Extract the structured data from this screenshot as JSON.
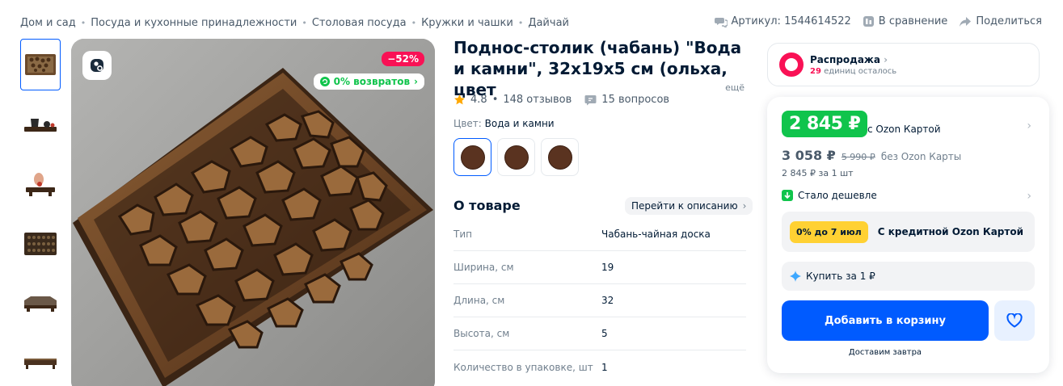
{
  "breadcrumbs": [
    "Дом и сад",
    "Посуда и кухонные принадлежности",
    "Столовая посуда",
    "Кружки и чашки",
    "Дайчай"
  ],
  "top_actions": {
    "article": "Артикул: 1544614522",
    "compare": "В сравнение",
    "share": "Поделиться"
  },
  "gallery": {
    "discount_badge": "−52%",
    "returns_badge": "0% возвратов",
    "thumbnails": [
      "thumb-top",
      "thumb-teaset",
      "thumb-hand",
      "thumb-pattern",
      "thumb-side",
      "thumb-edge"
    ]
  },
  "product": {
    "title": "Поднос-столик (чабань) \"Вода и камни\", 32x19x5 см (ольха, цвет",
    "title_more": "ещё",
    "rating": "4.8",
    "reviews": "148 отзывов",
    "questions": "15 вопросов",
    "color_label": "Цвет:",
    "color_value": "Вода и камни",
    "about_title": "О товаре",
    "goto_description": "Перейти к описанию",
    "specs": [
      {
        "k": "Тип",
        "v": "Чабань-чайная доска"
      },
      {
        "k": "Ширина, см",
        "v": "19"
      },
      {
        "k": "Длина, см",
        "v": "32"
      },
      {
        "k": "Высота, см",
        "v": "5"
      },
      {
        "k": "Количество в упаковке, шт",
        "v": "1"
      }
    ]
  },
  "sale": {
    "title": "Распродажа",
    "count": "29",
    "remaining": "единиц осталось"
  },
  "price": {
    "ozon_price": "2 845 ₽",
    "ozon_label": "с Ozon Картой",
    "regular_price": "3 058 ₽",
    "old_price": "5 990 ₽",
    "regular_label": "без Ozon Карты",
    "unit_price": "2 845 ₽ за 1 шт",
    "cheaper": "Стало дешевле",
    "credit_tag": "0% до 7 июл",
    "credit_text": "С кредитной Ozon Картой",
    "buy_for": "Купить за 1 ₽",
    "add_to_cart": "Добавить в корзину",
    "delivery": "Доставим завтра"
  },
  "colors": {
    "ozon_blue": "#005bff",
    "ozon_green": "#10c44c",
    "sale_pink": "#f91155",
    "credit_yellow": "#ffd133",
    "wood": "#5a3320"
  }
}
